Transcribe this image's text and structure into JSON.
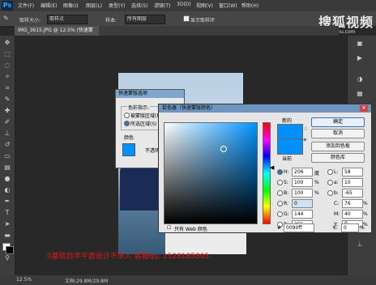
{
  "menubar": {
    "logo": "Ps",
    "items": [
      "文件(F)",
      "编辑(E)",
      "图像(I)",
      "图层(L)",
      "类型(Y)",
      "选择(S)",
      "滤镜(T)",
      "3D(D)",
      "视图(V)",
      "窗口(W)",
      "帮助(H)"
    ]
  },
  "options": {
    "size_label": "取样大小:",
    "size_value": "取样点",
    "sample_label": "样本:",
    "sample_value": "所有图层",
    "ring_label": "显示取样环"
  },
  "watermark": {
    "brand": "搜狐视频",
    "url": "tv.sohu.com"
  },
  "document": {
    "tab_label": "IMG_3615.JPG @ 12.5% (快速蒙版/8) *"
  },
  "status": {
    "zoom": "12.5%",
    "doc": "文档:29.8M/29.8M"
  },
  "overlay_text": "0基础自学平面设计不求人 客服qq: 1528185805",
  "quick_mask": {
    "title": "快速蒙版选项",
    "group_label": "色彩指示:",
    "opt1": "被蒙版区域(M)",
    "opt2": "所选区域(S)",
    "color_label": "颜色",
    "opacity_label": "不透明"
  },
  "color_picker": {
    "title": "拾色器（快速蒙版颜色）",
    "new_label": "新的",
    "current_label": "当前",
    "buttons": {
      "ok": "确定",
      "cancel": "取消",
      "add": "添加到色板",
      "library": "颜色库"
    },
    "hsb": {
      "H": "206",
      "H_unit": "度",
      "S": "100",
      "S_unit": "%",
      "B": "100",
      "B_unit": "%"
    },
    "rgb": {
      "R": "0",
      "G": "144",
      "B": "255"
    },
    "lab": {
      "L": "58",
      "a": "10",
      "b": "-65"
    },
    "cmyk": {
      "C": "76",
      "M": "40",
      "Y": "0",
      "K": "0",
      "unit": "%"
    },
    "hex_label": "#",
    "hex": "0090ff",
    "web_only": "只有 Web 颜色"
  },
  "colors": {
    "picked": "#0090ff",
    "overlay_red": "#e01818"
  }
}
